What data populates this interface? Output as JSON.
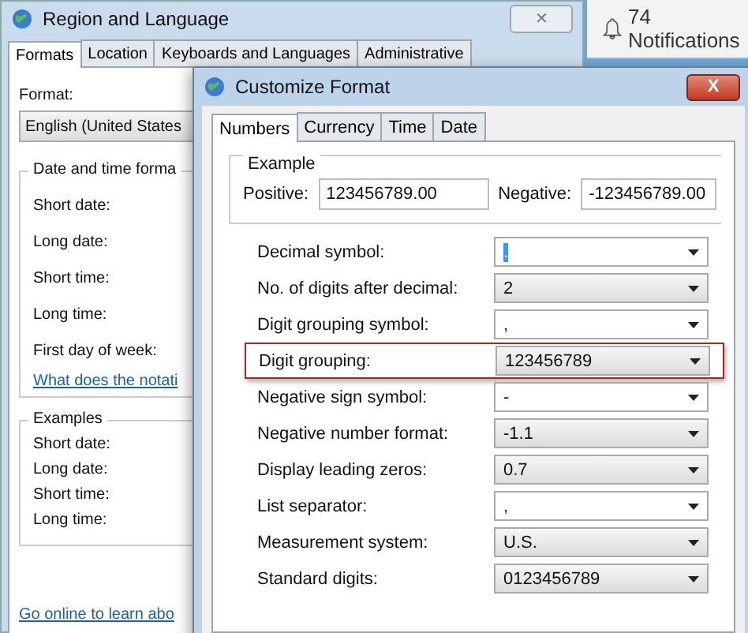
{
  "notifications": {
    "label": "74 Notifications"
  },
  "back_window": {
    "title": "Region and Language",
    "close": "✕",
    "tabs": [
      {
        "label": "Formats",
        "selected": true
      },
      {
        "label": "Location",
        "selected": false
      },
      {
        "label": "Keyboards and Languages",
        "selected": false
      },
      {
        "label": "Administrative",
        "selected": false
      }
    ],
    "format_label": "Format:",
    "format_value": "English (United States",
    "date_group": {
      "title": "Date and time forma",
      "labels": [
        "Short date:",
        "Long date:",
        "Short time:",
        "Long time:",
        "First day of week:"
      ],
      "link": "What does the notati"
    },
    "examples_group": {
      "title": "Examples",
      "labels": [
        "Short date:",
        "Long date:",
        "Short time:",
        "Long time:"
      ]
    },
    "online_link": "Go online to learn abo"
  },
  "dialog": {
    "title": "Customize Format",
    "close": "X",
    "tabs": [
      {
        "label": "Numbers",
        "selected": true
      },
      {
        "label": "Currency",
        "selected": false
      },
      {
        "label": "Time",
        "selected": false
      },
      {
        "label": "Date",
        "selected": false
      }
    ],
    "example": {
      "title": "Example",
      "positive_label": "Positive:",
      "positive_value": "123456789.00",
      "negative_label": "Negative:",
      "negative_value": "-123456789.00"
    },
    "rows": [
      {
        "label": "Decimal symbol:",
        "value": ".",
        "kind": "editable",
        "focused": true,
        "highlighted": false
      },
      {
        "label": "No. of digits after decimal:",
        "value": "2",
        "kind": "list",
        "focused": false,
        "highlighted": false
      },
      {
        "label": "Digit grouping symbol:",
        "value": ",",
        "kind": "editable",
        "focused": false,
        "highlighted": false
      },
      {
        "label": "Digit grouping:",
        "value": "123456789",
        "kind": "list",
        "focused": false,
        "highlighted": true
      },
      {
        "label": "Negative sign symbol:",
        "value": "-",
        "kind": "editable",
        "focused": false,
        "highlighted": false
      },
      {
        "label": "Negative number format:",
        "value": "-1.1",
        "kind": "list",
        "focused": false,
        "highlighted": false
      },
      {
        "label": "Display leading zeros:",
        "value": "0.7",
        "kind": "list",
        "focused": false,
        "highlighted": false
      },
      {
        "label": "List separator:",
        "value": ",",
        "kind": "editable",
        "focused": false,
        "highlighted": false
      },
      {
        "label": "Measurement system:",
        "value": "U.S.",
        "kind": "list",
        "focused": false,
        "highlighted": false
      },
      {
        "label": "Standard digits:",
        "value": "0123456789",
        "kind": "list",
        "focused": false,
        "highlighted": false
      }
    ]
  }
}
